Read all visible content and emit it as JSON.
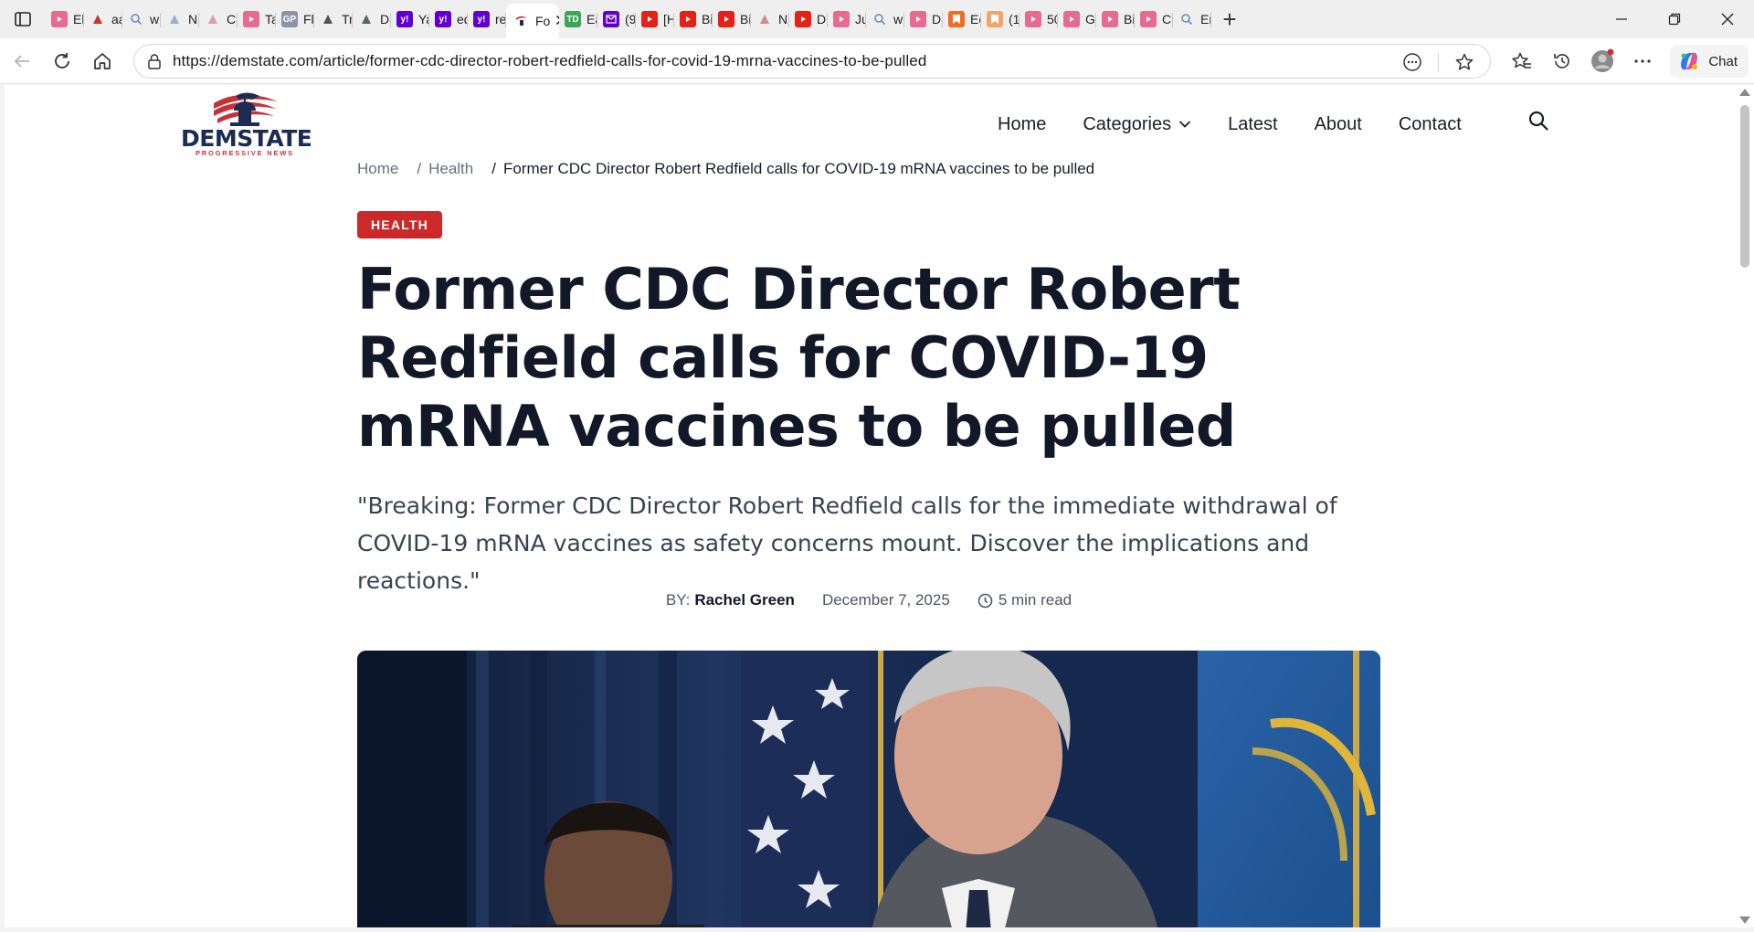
{
  "browser": {
    "tabs": [
      {
        "label": "El",
        "fav": "youtube-icon",
        "color": "#e76b91"
      },
      {
        "label": "aa",
        "fav": "pen-icon",
        "color": "#c0392b"
      },
      {
        "label": "w",
        "fav": "search-icon",
        "color": "#6d8fb6"
      },
      {
        "label": "N",
        "fav": "feather-icon",
        "color": "#9bb0c8"
      },
      {
        "label": "C",
        "fav": "bird-icon",
        "color": "#d8a0a8"
      },
      {
        "label": "Ta",
        "fav": "youtube-icon",
        "color": "#e76b91"
      },
      {
        "label": "Fl",
        "fav": "gp-icon",
        "color": "#8a94a6"
      },
      {
        "label": "Tr",
        "fav": "diamond-icon",
        "color": "#555"
      },
      {
        "label": "D",
        "fav": "stripes-icon",
        "color": "#5a6070"
      },
      {
        "label": "Ya",
        "fav": "yahoo-icon",
        "color": "#6001d2"
      },
      {
        "label": "ed",
        "fav": "yahoo-icon",
        "color": "#6001d2"
      },
      {
        "label": "re",
        "fav": "yahoo-icon",
        "color": "#6001d2"
      },
      {
        "label": "Fo",
        "fav": "site-icon",
        "color": "#ffffff",
        "active": true
      },
      {
        "label": "Ea",
        "fav": "td-icon",
        "color": "#3aa657"
      },
      {
        "label": "(9",
        "fav": "mail-icon",
        "color": "#6001d2"
      },
      {
        "label": "[H",
        "fav": "youtube-icon",
        "color": "#e62117"
      },
      {
        "label": "Bi",
        "fav": "youtube-icon",
        "color": "#e62117"
      },
      {
        "label": "Bi",
        "fav": "youtube-icon",
        "color": "#e62117"
      },
      {
        "label": "N",
        "fav": "hand-icon",
        "color": "#d08a8a"
      },
      {
        "label": "D",
        "fav": "youtube-icon",
        "color": "#e62117"
      },
      {
        "label": "Ju",
        "fav": "youtube-icon",
        "color": "#e76b91"
      },
      {
        "label": "w",
        "fav": "search-icon",
        "color": "#6d8fb6"
      },
      {
        "label": "D",
        "fav": "youtube-icon",
        "color": "#e76b91"
      },
      {
        "label": "Ec",
        "fav": "bookmark-icon",
        "color": "#ef6c21"
      },
      {
        "label": "(1",
        "fav": "bookmark-icon",
        "color": "#f0a56a"
      },
      {
        "label": "50",
        "fav": "youtube-icon",
        "color": "#e76b91"
      },
      {
        "label": "G",
        "fav": "youtube-icon",
        "color": "#e76b91"
      },
      {
        "label": "Bi",
        "fav": "youtube-icon",
        "color": "#e76b91"
      },
      {
        "label": "C",
        "fav": "youtube-icon",
        "color": "#e76b91"
      },
      {
        "label": "Er",
        "fav": "search-icon",
        "color": "#6d8fb6"
      }
    ],
    "url": "https://demstate.com/article/former-cdc-director-robert-redfield-calls-for-covid-19-mrna-vaccines-to-be-pulled",
    "chat_label": "Chat"
  },
  "site": {
    "logo_text": "DEMSTATE",
    "logo_tagline": "PROGRESSIVE NEWS",
    "nav": [
      "Home",
      "Categories",
      "Latest",
      "About",
      "Contact"
    ]
  },
  "article": {
    "breadcrumb": {
      "home": "Home",
      "sep": "/",
      "category": "Health",
      "current": "Former CDC Director Robert Redfield calls for COVID-19 mRNA vaccines to be pulled"
    },
    "badge": "HEALTH",
    "title": "Former CDC Director Robert Redfield calls for COVID-19 mRNA vaccines to be pulled",
    "summary": "\"Breaking: Former CDC Director Robert Redfield calls for the immediate withdrawal of COVID-19 mRNA vaccines as safety concerns mount. Discover the implications and reactions.\"",
    "by_label": "BY:",
    "author": "Rachel Green",
    "date": "December 7, 2025",
    "read_time": "5 min read"
  },
  "colors": {
    "accent": "#cc2a2a",
    "brand_navy": "#1c2b52",
    "text_dark": "#121827"
  }
}
